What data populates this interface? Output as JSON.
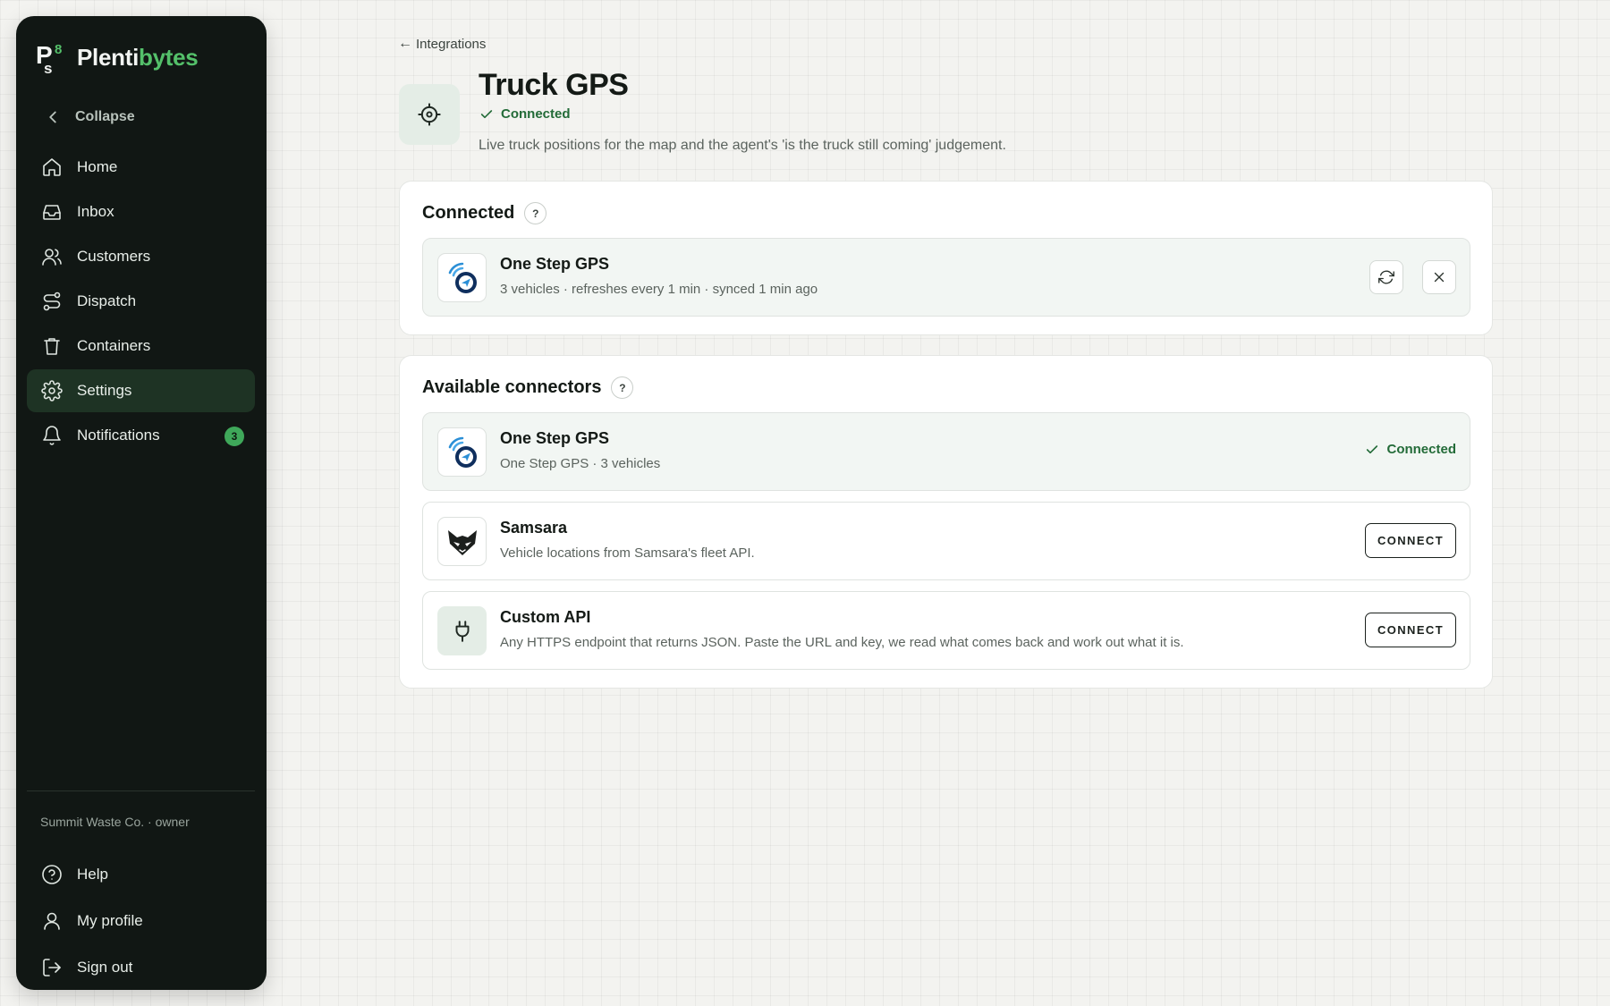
{
  "brand": {
    "name_part1": "Plenti",
    "name_part2": "bytes",
    "accent": "#54c06a"
  },
  "sidebar": {
    "collapse_label": "Collapse",
    "items": [
      {
        "label": "Home",
        "icon": "home-icon"
      },
      {
        "label": "Inbox",
        "icon": "inbox-icon"
      },
      {
        "label": "Customers",
        "icon": "users-icon"
      },
      {
        "label": "Dispatch",
        "icon": "route-icon"
      },
      {
        "label": "Containers",
        "icon": "trash-icon"
      },
      {
        "label": "Settings",
        "icon": "gear-icon",
        "active": true
      },
      {
        "label": "Notifications",
        "icon": "bell-icon",
        "badge": "3"
      }
    ],
    "org_line": "Summit Waste Co. · owner",
    "bottom_items": [
      {
        "label": "Help",
        "icon": "help-circle-icon"
      },
      {
        "label": "My profile",
        "icon": "user-icon"
      },
      {
        "label": "Sign out",
        "icon": "sign-out-icon"
      }
    ]
  },
  "page": {
    "back_arrow": "←",
    "back_label": "Integrations",
    "title": "Truck GPS",
    "status": "Connected",
    "description": "Live truck positions for the map and the agent's 'is the truck still coming' judgement.",
    "status_color": "#236b38"
  },
  "connected_section": {
    "title": "Connected",
    "help": "?",
    "item": {
      "name": "One Step GPS",
      "detail": "3 vehicles · refreshes every 1 min · synced 1 min ago",
      "icon": "onestep-gps-logo-icon"
    }
  },
  "available_section": {
    "title": "Available connectors",
    "help": "?",
    "connectors": [
      {
        "name": "One Step GPS",
        "detail": "One Step GPS · 3 vehicles",
        "status": "Connected",
        "icon": "onestep-gps-logo-icon"
      },
      {
        "name": "Samsara",
        "detail": "Vehicle locations from Samsara's fleet API.",
        "action": "CONNECT",
        "icon": "samsara-logo-icon"
      },
      {
        "name": "Custom API",
        "detail": "Any HTTPS endpoint that returns JSON. Paste the URL and key, we read what comes back and work out what it is.",
        "action": "CONNECT",
        "icon": "plug-icon"
      }
    ]
  }
}
